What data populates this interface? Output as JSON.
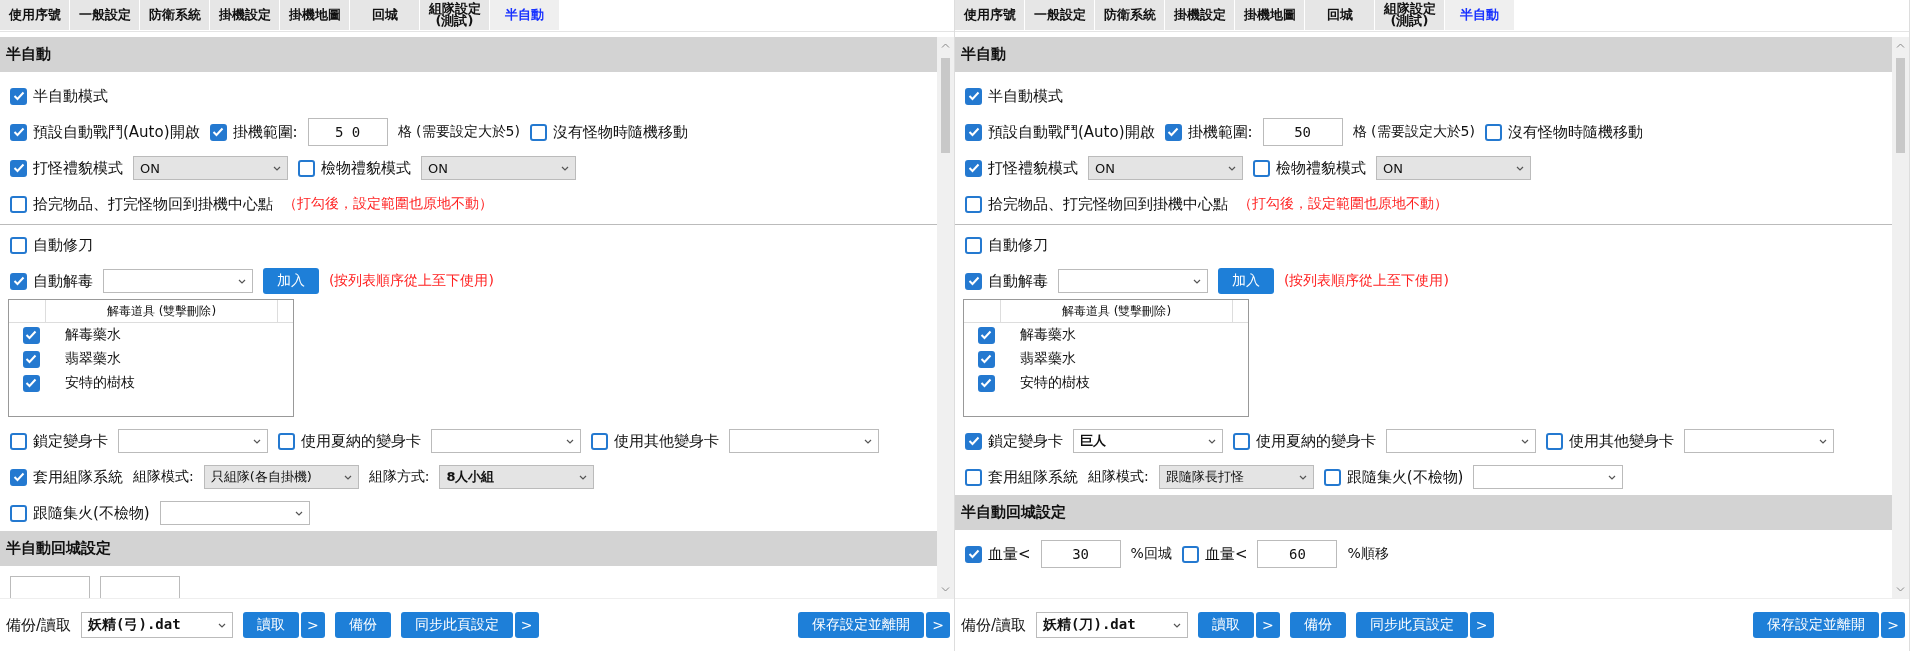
{
  "panels": [
    {
      "tabs": [
        {
          "label": "使用序號",
          "selected": false
        },
        {
          "label": "一般設定",
          "selected": false
        },
        {
          "label": "防衛系統",
          "selected": false
        },
        {
          "label": "掛機設定",
          "selected": false
        },
        {
          "label": "掛機地圖",
          "selected": false
        },
        {
          "label": "回城",
          "selected": false
        },
        {
          "label": "組隊設定\n(測試)",
          "selected": false
        },
        {
          "label": "半自動",
          "selected": true
        }
      ],
      "blocks": [
        {
          "kind": "header",
          "title": "半自動"
        },
        {
          "kind": "row",
          "items": [
            {
              "kind": "checkbox",
              "label": "半自動模式",
              "checked": true
            }
          ]
        },
        {
          "kind": "row",
          "items": [
            {
              "kind": "checkbox",
              "label": "預設自動戰鬥(Auto)開啟",
              "checked": true
            },
            {
              "kind": "checkbox",
              "label": "掛機範圍:",
              "checked": true
            },
            {
              "kind": "input",
              "value": "5 0"
            },
            {
              "kind": "label",
              "text": "格 (需要設定大於5)"
            },
            {
              "kind": "checkbox",
              "label": "沒有怪物時隨機移動",
              "checked": false
            }
          ]
        },
        {
          "kind": "row",
          "items": [
            {
              "kind": "checkbox",
              "label": "打怪禮貌模式",
              "checked": true
            },
            {
              "kind": "combo",
              "value": "ON"
            },
            {
              "kind": "checkbox",
              "label": "檢物禮貌模式",
              "checked": false
            },
            {
              "kind": "combo",
              "value": "ON"
            }
          ]
        },
        {
          "kind": "row",
          "items": [
            {
              "kind": "checkbox",
              "label": "拾完物品、打完怪物回到掛機中心點",
              "checked": false
            },
            {
              "kind": "note",
              "text": "（打勾後，設定範圍也原地不動）"
            }
          ]
        },
        {
          "kind": "rule"
        },
        {
          "kind": "row",
          "items": [
            {
              "kind": "checkbox",
              "label": "自動修刀",
              "checked": false
            }
          ]
        },
        {
          "kind": "row",
          "items": [
            {
              "kind": "checkbox",
              "label": "自動解毒",
              "checked": true
            },
            {
              "kind": "select"
            },
            {
              "kind": "button",
              "label": "加入"
            },
            {
              "kind": "note",
              "text": "(按列表順序從上至下使用)"
            }
          ]
        },
        {
          "kind": "table",
          "column": "解毒道具 (雙擊刪除)",
          "rows": [
            {
              "name": "解毒藥水",
              "checked": true
            },
            {
              "name": "翡翠藥水",
              "checked": true
            },
            {
              "name": "安特的樹枝",
              "checked": true
            }
          ]
        },
        {
          "kind": "row",
          "items": [
            {
              "kind": "checkbox",
              "label": "鎖定變身卡",
              "checked": false
            },
            {
              "kind": "select"
            },
            {
              "kind": "checkbox",
              "label": "使用夏納的變身卡",
              "checked": false
            },
            {
              "kind": "select"
            },
            {
              "kind": "checkbox",
              "label": "使用其他變身卡",
              "checked": false
            },
            {
              "kind": "select"
            }
          ]
        },
        {
          "kind": "row",
          "items": [
            {
              "kind": "checkbox",
              "label": "套用組隊系統",
              "checked": true
            },
            {
              "kind": "label",
              "text": "組隊模式:"
            },
            {
              "kind": "combo",
              "value": "只組隊(各自掛機)"
            },
            {
              "kind": "label",
              "text": "組隊方式:"
            },
            {
              "kind": "combo",
              "value": "8人小組",
              "bold": true
            }
          ]
        },
        {
          "kind": "row",
          "items": [
            {
              "kind": "checkbox",
              "label": "跟隨集火(不檢物)",
              "checked": false
            },
            {
              "kind": "select"
            }
          ]
        },
        {
          "kind": "header",
          "title": "半自動回城設定"
        },
        {
          "kind": "row",
          "items": [
            {
              "kind": "input"
            },
            {
              "kind": "input"
            }
          ]
        }
      ],
      "footer": {
        "label": "備份/讀取",
        "file": "妖精(弓).dat",
        "buttons": [
          {
            "kind": "button",
            "label": "讀取"
          },
          {
            "kind": "arrow",
            "label": ">"
          },
          {
            "kind": "button",
            "label": "備份"
          },
          {
            "kind": "button",
            "label": "同步此頁設定"
          },
          {
            "kind": "arrow",
            "label": ">"
          }
        ],
        "end_buttons": [
          {
            "kind": "button",
            "label": "保存設定並離開"
          },
          {
            "kind": "arrow",
            "label": ">"
          }
        ]
      }
    },
    {
      "tabs": [
        {
          "label": "使用序號",
          "selected": false
        },
        {
          "label": "一般設定",
          "selected": false
        },
        {
          "label": "防衛系統",
          "selected": false
        },
        {
          "label": "掛機設定",
          "selected": false
        },
        {
          "label": "掛機地圖",
          "selected": false
        },
        {
          "label": "回城",
          "selected": false
        },
        {
          "label": "組隊設定\n(測試)",
          "selected": false
        },
        {
          "label": "半自動",
          "selected": true
        }
      ],
      "blocks": [
        {
          "kind": "header",
          "title": "半自動"
        },
        {
          "kind": "row",
          "items": [
            {
              "kind": "checkbox",
              "label": "半自動模式",
              "checked": true
            }
          ]
        },
        {
          "kind": "row",
          "items": [
            {
              "kind": "checkbox",
              "label": "預設自動戰鬥(Auto)開啟",
              "checked": true
            },
            {
              "kind": "checkbox",
              "label": "掛機範圍:",
              "checked": true
            },
            {
              "kind": "input",
              "value": "50"
            },
            {
              "kind": "label",
              "text": "格 (需要設定大於5)"
            },
            {
              "kind": "checkbox",
              "label": "沒有怪物時隨機移動",
              "checked": false
            }
          ]
        },
        {
          "kind": "row",
          "items": [
            {
              "kind": "checkbox",
              "label": "打怪禮貌模式",
              "checked": true
            },
            {
              "kind": "combo",
              "value": "ON"
            },
            {
              "kind": "checkbox",
              "label": "檢物禮貌模式",
              "checked": false
            },
            {
              "kind": "combo",
              "value": "ON"
            }
          ]
        },
        {
          "kind": "row",
          "items": [
            {
              "kind": "checkbox",
              "label": "拾完物品、打完怪物回到掛機中心點",
              "checked": false
            },
            {
              "kind": "note",
              "text": "（打勾後，設定範圍也原地不動）"
            }
          ]
        },
        {
          "kind": "rule"
        },
        {
          "kind": "row",
          "items": [
            {
              "kind": "checkbox",
              "label": "自動修刀",
              "checked": false
            }
          ]
        },
        {
          "kind": "row",
          "items": [
            {
              "kind": "checkbox",
              "label": "自動解毒",
              "checked": true
            },
            {
              "kind": "select"
            },
            {
              "kind": "button",
              "label": "加入"
            },
            {
              "kind": "note",
              "text": "(按列表順序從上至下使用)"
            }
          ]
        },
        {
          "kind": "table",
          "column": "解毒道具 (雙擊刪除)",
          "rows": [
            {
              "name": "解毒藥水",
              "checked": true
            },
            {
              "name": "翡翠藥水",
              "checked": true
            },
            {
              "name": "安特的樹枝",
              "checked": true
            }
          ]
        },
        {
          "kind": "row",
          "items": [
            {
              "kind": "checkbox",
              "label": "鎖定變身卡",
              "checked": true
            },
            {
              "kind": "select",
              "value": "巨人",
              "bold": true
            },
            {
              "kind": "checkbox",
              "label": "使用夏納的變身卡",
              "checked": false
            },
            {
              "kind": "select"
            },
            {
              "kind": "checkbox",
              "label": "使用其他變身卡",
              "checked": false
            },
            {
              "kind": "select"
            }
          ]
        },
        {
          "kind": "row",
          "items": [
            {
              "kind": "checkbox",
              "label": "套用組隊系統",
              "checked": false
            },
            {
              "kind": "label",
              "text": "組隊模式:"
            },
            {
              "kind": "combo",
              "value": "跟隨隊長打怪"
            },
            {
              "kind": "checkbox",
              "label": "跟隨集火(不檢物)",
              "checked": false
            },
            {
              "kind": "select"
            }
          ]
        },
        {
          "kind": "header",
          "title": "半自動回城設定"
        },
        {
          "kind": "row",
          "items": [
            {
              "kind": "checkbox",
              "label": "血量<",
              "checked": true
            },
            {
              "kind": "input",
              "value": "30"
            },
            {
              "kind": "label",
              "text": "%回城"
            },
            {
              "kind": "checkbox",
              "label": "血量<",
              "checked": false
            },
            {
              "kind": "input",
              "value": "60"
            },
            {
              "kind": "label",
              "text": "%順移"
            }
          ]
        }
      ],
      "footer": {
        "label": "備份/讀取",
        "file": "妖精(刀).dat",
        "buttons": [
          {
            "kind": "button",
            "label": "讀取"
          },
          {
            "kind": "arrow",
            "label": ">"
          },
          {
            "kind": "button",
            "label": "備份"
          },
          {
            "kind": "button",
            "label": "同步此頁設定"
          },
          {
            "kind": "arrow",
            "label": ">"
          }
        ],
        "end_buttons": [
          {
            "kind": "button",
            "label": "保存設定並離開"
          },
          {
            "kind": "arrow",
            "label": ">"
          }
        ]
      }
    }
  ]
}
